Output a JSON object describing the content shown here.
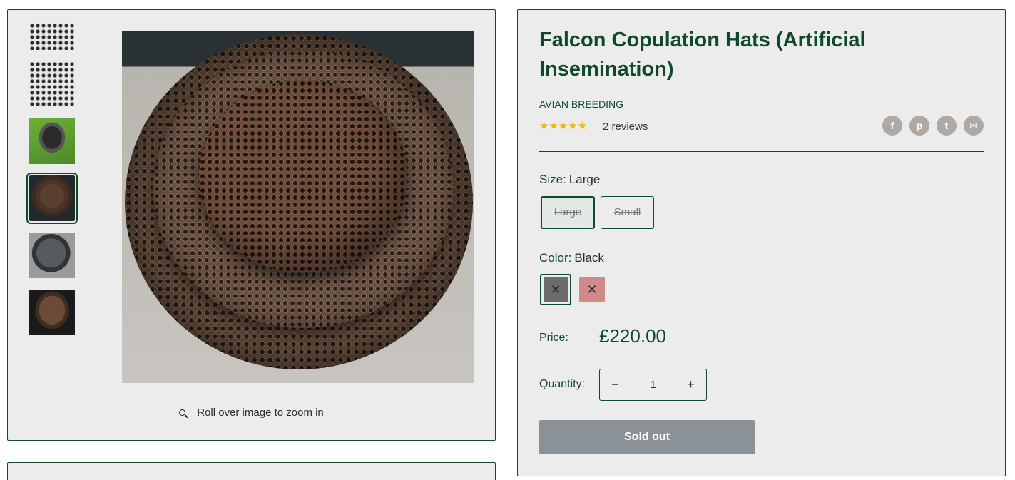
{
  "gallery": {
    "thumbnails": [
      {
        "name": "thumbnail-1",
        "style": "dots"
      },
      {
        "name": "thumbnail-2",
        "style": "dots"
      },
      {
        "name": "thumbnail-3",
        "style": "grass"
      },
      {
        "name": "thumbnail-4",
        "style": "brown",
        "selected": true
      },
      {
        "name": "thumbnail-5",
        "style": "grey"
      },
      {
        "name": "thumbnail-6",
        "style": "brown-dark"
      }
    ],
    "zoom_hint": "Roll over image to zoom in"
  },
  "product": {
    "title": "Falcon Copulation Hats (Artificial Insemination)",
    "vendor": "AVIAN BREEDING",
    "rating_stars": "★★★★★",
    "rating": 5,
    "reviews": "2 reviews",
    "share_icons": [
      "facebook-icon",
      "pinterest-icon",
      "twitter-icon",
      "email-icon"
    ],
    "size": {
      "label": "Size:",
      "selected": "Large",
      "options": [
        "Large",
        "Small"
      ]
    },
    "color": {
      "label": "Color:",
      "selected": "Black",
      "swatches": [
        {
          "name": "black",
          "hex": "#6b6b6b",
          "unavailable": true
        },
        {
          "name": "pink",
          "hex": "#d08a8a",
          "unavailable": true
        }
      ]
    },
    "price_label": "Price:",
    "price": "£220.00",
    "quantity_label": "Quantity:",
    "quantity": "1",
    "minus": "−",
    "plus": "+",
    "button": "Sold out"
  },
  "colors": {
    "brand_green": "#0e4a2a",
    "panel_bg": "#ececec",
    "star": "#f5b800",
    "soldout_bg": "#8a9297"
  }
}
